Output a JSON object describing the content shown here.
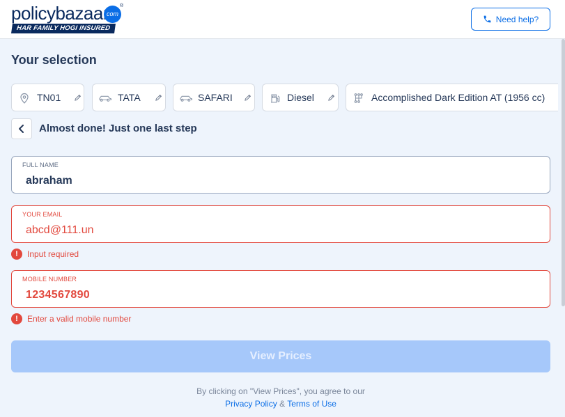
{
  "header": {
    "logo": {
      "wordmark": "policybazaar",
      "dotcom": "com",
      "registered": "®",
      "tagline": "HAR FAMILY HOGI INSURED"
    },
    "help_label": "Need help?"
  },
  "selection": {
    "title": "Your selection",
    "chips": [
      {
        "label": "TN01",
        "icon": "location-pin-icon"
      },
      {
        "label": "TATA",
        "icon": "car-icon"
      },
      {
        "label": "SAFARI",
        "icon": "car-icon"
      },
      {
        "label": "Diesel",
        "icon": "fuel-pump-icon"
      },
      {
        "label": "Accomplished Dark Edition AT (1956 cc)",
        "icon": "gear-shift-icon"
      }
    ]
  },
  "step": {
    "title": "Almost done! Just one last step"
  },
  "form": {
    "full_name": {
      "label": "FULL NAME",
      "value": "abraham"
    },
    "email": {
      "label": "YOUR EMAIL",
      "value": "abcd@111.un",
      "error": "Input required"
    },
    "mobile": {
      "label": "MOBILE NUMBER",
      "value": "1234567890",
      "error": "Enter a valid mobile number"
    }
  },
  "cta": {
    "label": "View Prices"
  },
  "terms": {
    "prefix": "By clicking on \"View Prices\", you agree to our",
    "privacy_link": "Privacy Policy",
    "amp": "&",
    "terms_link": "Terms of Use"
  },
  "colors": {
    "brand_blue": "#0b6ee6",
    "navy": "#0a2a5e",
    "error_red": "#e2483d",
    "cta_disabled": "#a6c8fa",
    "page_bg": "#eef4fc"
  }
}
